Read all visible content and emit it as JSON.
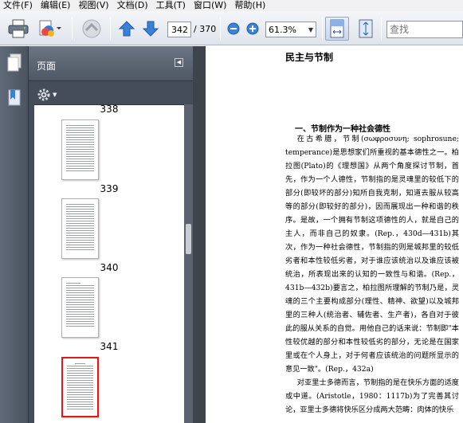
{
  "menu": [
    "文件(F)",
    "编辑(E)",
    "视图(V)",
    "文档(D)",
    "工具(T)",
    "窗口(W)",
    "帮助(H)"
  ],
  "toolbar": {
    "current_page": "342",
    "total_pages": "/ 370",
    "zoom": "61.3%",
    "search_placeholder": "查找"
  },
  "panel": {
    "title": "页面",
    "thumbnails": [
      {
        "label": "338"
      },
      {
        "label": "339"
      },
      {
        "label": "340"
      },
      {
        "label": "341"
      }
    ]
  },
  "doc": {
    "title": "民主与节制",
    "section": "一、节制作为一种社会德性",
    "paragraphs": [
      "在古希腊，节制(σωφροσυνη; sophrosune; temperance)是思想家们所重视的基本德性之一。柏拉图(Plato)的《理想国》从两个角度探讨节制，首先，作为一个人德性，节制指的是灵魂里的较低下的部分(即较坏的部分)知所自我克制，知道去服从较高等的部分(即较好的部分)，因而展现出一种和谐的秩序。是故，一个拥有节制这项德性的人，就是自己的主人，而非自己的奴隶。(Rep.，430d—431b)其次，作为一种社会德性，节制指的则是城邦里的较低劣者和本性较低劣者，对于谁应该统治以及谁应该被统治，所表现出来的认知的一致性与和谐。(Rep.，431b—432b)要言之，柏拉图所理解的节制乃是，灵魂的三个主要构成部分(理性、精神、欲望)以及城邦里的三种人(统治者、辅佐者、生产者)，各自对于彼此的服从关系的自觉。用他自己的话来说：节制即\"本性较优越的部分和本性较低劣的部分，无论是在国家里或在个人身上，对于何者应该统治的问题所显示的意见一致\"。(Rep.，432a)",
      "对亚里士多德而言，节制指的是在快乐方面的适度或中道。(Aristotle，1980：1117b)为了完善其讨论，亚里士多德将快乐区分成两大范畴：肉体的快乐"
    ]
  }
}
